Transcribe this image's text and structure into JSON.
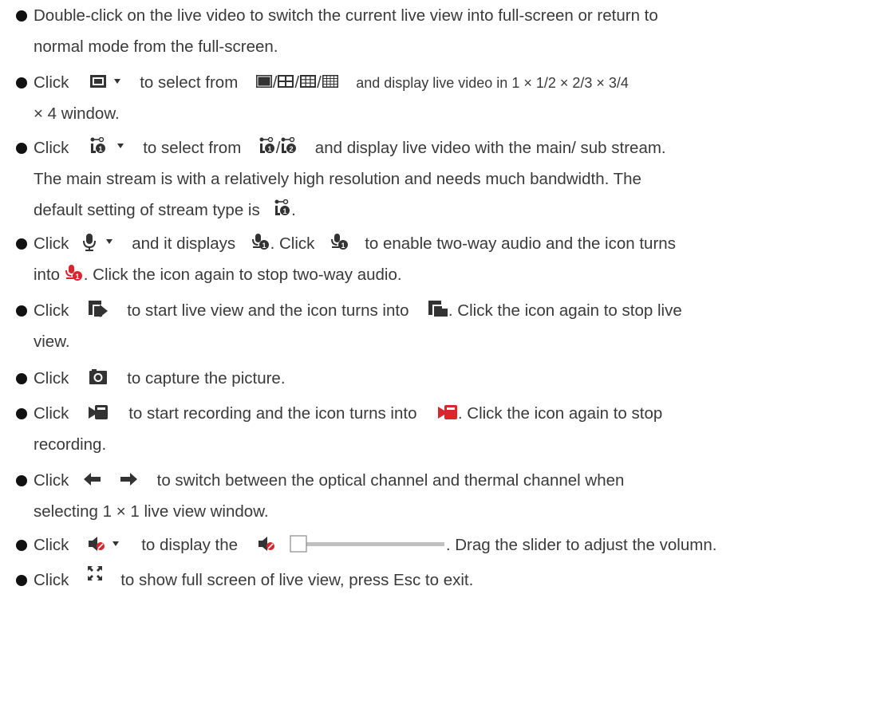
{
  "items": [
    {
      "l1": "Double-click on the live video to switch the current live view into full-screen or return to",
      "l2": "normal mode from the full-screen."
    },
    {
      "a": "Click",
      "b": "to select from",
      "c": "/",
      "d": "/",
      "e": "/",
      "f": "and display live video in 1 × 1/2 × 2/3 × 3/4",
      "l2": "× 4 window."
    },
    {
      "a": "Click",
      "b": "to select from",
      "c": "/",
      "d": "and display live video with the main/ sub stream.",
      "l2": "The main stream is with a relatively high resolution and needs much bandwidth. The",
      "l3a": "default setting of stream type is",
      "l3b": "."
    },
    {
      "a": "Click",
      "b": "and it displays",
      "c": ". Click",
      "d": "to enable two-way audio and the icon turns",
      "l2a": "into",
      "l2b": ". Click the icon again to stop two-way audio."
    },
    {
      "a": "Click",
      "b": "to start live view and the icon turns into",
      "c": ". Click the icon again to stop live",
      "l2": "view."
    },
    {
      "a": "Click",
      "b": "to capture the picture."
    },
    {
      "a": "Click",
      "b": "to start recording and the icon turns into",
      "c": ". Click the icon again to stop",
      "l2": "recording."
    },
    {
      "a": "Click",
      "b": "to switch between the optical channel and thermal channel when",
      "l2": "selecting 1 × 1 live view window."
    },
    {
      "a": "Click",
      "b": "to display the",
      "c": ". Drag the slider to adjust the volumn."
    },
    {
      "a": "Click",
      "b": "to show full screen of live view, press Esc to exit."
    }
  ],
  "icons": {
    "dark": "#333333",
    "red": "#d9262c",
    "slider_track": "#c0c0c0",
    "stream_main": "stream-main-icon",
    "stream_sub": "stream-sub-icon",
    "mic": "mic-icon",
    "live_view_start": "live-view-start-icon",
    "live_view_stop": "live-view-stop-icon",
    "capture": "camera-icon",
    "record": "record-icon",
    "arrows": "arrow-icons",
    "volume": "volume-muted-icon",
    "full_screen": "full-screen-icon"
  }
}
